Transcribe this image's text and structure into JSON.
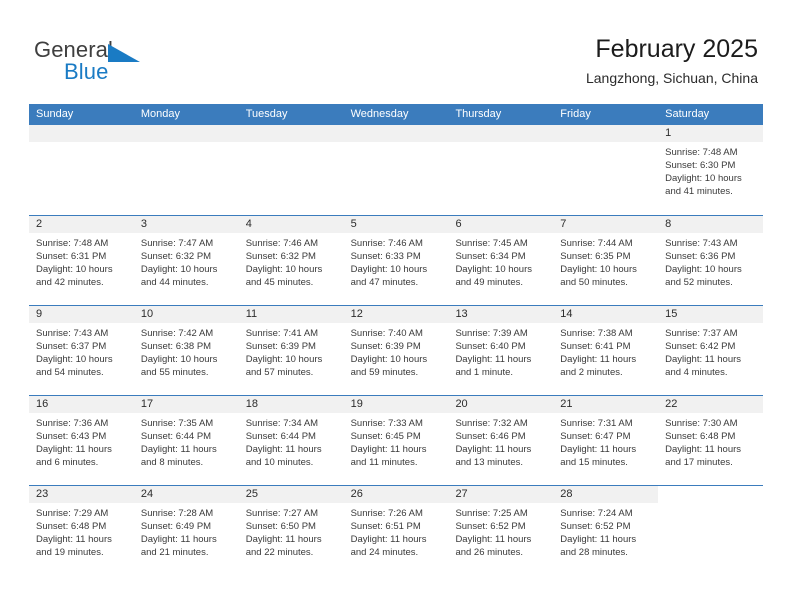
{
  "brand": {
    "name_part1": "General",
    "name_part2": "Blue",
    "accent_color": "#1a7bc4"
  },
  "header": {
    "title": "February 2025",
    "subtitle": "Langzhong, Sichuan, China"
  },
  "calendar": {
    "header_color": "#3b7cbd",
    "band_color": "#f1f1f1",
    "weekdays": [
      "Sunday",
      "Monday",
      "Tuesday",
      "Wednesday",
      "Thursday",
      "Friday",
      "Saturday"
    ],
    "weeks": [
      [
        {
          "day": "",
          "empty": true
        },
        {
          "day": "",
          "empty": true
        },
        {
          "day": "",
          "empty": true
        },
        {
          "day": "",
          "empty": true
        },
        {
          "day": "",
          "empty": true
        },
        {
          "day": "",
          "empty": true
        },
        {
          "day": "1",
          "sunrise": "Sunrise: 7:48 AM",
          "sunset": "Sunset: 6:30 PM",
          "daylight": "Daylight: 10 hours and 41 minutes."
        }
      ],
      [
        {
          "day": "2",
          "sunrise": "Sunrise: 7:48 AM",
          "sunset": "Sunset: 6:31 PM",
          "daylight": "Daylight: 10 hours and 42 minutes."
        },
        {
          "day": "3",
          "sunrise": "Sunrise: 7:47 AM",
          "sunset": "Sunset: 6:32 PM",
          "daylight": "Daylight: 10 hours and 44 minutes."
        },
        {
          "day": "4",
          "sunrise": "Sunrise: 7:46 AM",
          "sunset": "Sunset: 6:32 PM",
          "daylight": "Daylight: 10 hours and 45 minutes."
        },
        {
          "day": "5",
          "sunrise": "Sunrise: 7:46 AM",
          "sunset": "Sunset: 6:33 PM",
          "daylight": "Daylight: 10 hours and 47 minutes."
        },
        {
          "day": "6",
          "sunrise": "Sunrise: 7:45 AM",
          "sunset": "Sunset: 6:34 PM",
          "daylight": "Daylight: 10 hours and 49 minutes."
        },
        {
          "day": "7",
          "sunrise": "Sunrise: 7:44 AM",
          "sunset": "Sunset: 6:35 PM",
          "daylight": "Daylight: 10 hours and 50 minutes."
        },
        {
          "day": "8",
          "sunrise": "Sunrise: 7:43 AM",
          "sunset": "Sunset: 6:36 PM",
          "daylight": "Daylight: 10 hours and 52 minutes."
        }
      ],
      [
        {
          "day": "9",
          "sunrise": "Sunrise: 7:43 AM",
          "sunset": "Sunset: 6:37 PM",
          "daylight": "Daylight: 10 hours and 54 minutes."
        },
        {
          "day": "10",
          "sunrise": "Sunrise: 7:42 AM",
          "sunset": "Sunset: 6:38 PM",
          "daylight": "Daylight: 10 hours and 55 minutes."
        },
        {
          "day": "11",
          "sunrise": "Sunrise: 7:41 AM",
          "sunset": "Sunset: 6:39 PM",
          "daylight": "Daylight: 10 hours and 57 minutes."
        },
        {
          "day": "12",
          "sunrise": "Sunrise: 7:40 AM",
          "sunset": "Sunset: 6:39 PM",
          "daylight": "Daylight: 10 hours and 59 minutes."
        },
        {
          "day": "13",
          "sunrise": "Sunrise: 7:39 AM",
          "sunset": "Sunset: 6:40 PM",
          "daylight": "Daylight: 11 hours and 1 minute."
        },
        {
          "day": "14",
          "sunrise": "Sunrise: 7:38 AM",
          "sunset": "Sunset: 6:41 PM",
          "daylight": "Daylight: 11 hours and 2 minutes."
        },
        {
          "day": "15",
          "sunrise": "Sunrise: 7:37 AM",
          "sunset": "Sunset: 6:42 PM",
          "daylight": "Daylight: 11 hours and 4 minutes."
        }
      ],
      [
        {
          "day": "16",
          "sunrise": "Sunrise: 7:36 AM",
          "sunset": "Sunset: 6:43 PM",
          "daylight": "Daylight: 11 hours and 6 minutes."
        },
        {
          "day": "17",
          "sunrise": "Sunrise: 7:35 AM",
          "sunset": "Sunset: 6:44 PM",
          "daylight": "Daylight: 11 hours and 8 minutes."
        },
        {
          "day": "18",
          "sunrise": "Sunrise: 7:34 AM",
          "sunset": "Sunset: 6:44 PM",
          "daylight": "Daylight: 11 hours and 10 minutes."
        },
        {
          "day": "19",
          "sunrise": "Sunrise: 7:33 AM",
          "sunset": "Sunset: 6:45 PM",
          "daylight": "Daylight: 11 hours and 11 minutes."
        },
        {
          "day": "20",
          "sunrise": "Sunrise: 7:32 AM",
          "sunset": "Sunset: 6:46 PM",
          "daylight": "Daylight: 11 hours and 13 minutes."
        },
        {
          "day": "21",
          "sunrise": "Sunrise: 7:31 AM",
          "sunset": "Sunset: 6:47 PM",
          "daylight": "Daylight: 11 hours and 15 minutes."
        },
        {
          "day": "22",
          "sunrise": "Sunrise: 7:30 AM",
          "sunset": "Sunset: 6:48 PM",
          "daylight": "Daylight: 11 hours and 17 minutes."
        }
      ],
      [
        {
          "day": "23",
          "sunrise": "Sunrise: 7:29 AM",
          "sunset": "Sunset: 6:48 PM",
          "daylight": "Daylight: 11 hours and 19 minutes."
        },
        {
          "day": "24",
          "sunrise": "Sunrise: 7:28 AM",
          "sunset": "Sunset: 6:49 PM",
          "daylight": "Daylight: 11 hours and 21 minutes."
        },
        {
          "day": "25",
          "sunrise": "Sunrise: 7:27 AM",
          "sunset": "Sunset: 6:50 PM",
          "daylight": "Daylight: 11 hours and 22 minutes."
        },
        {
          "day": "26",
          "sunrise": "Sunrise: 7:26 AM",
          "sunset": "Sunset: 6:51 PM",
          "daylight": "Daylight: 11 hours and 24 minutes."
        },
        {
          "day": "27",
          "sunrise": "Sunrise: 7:25 AM",
          "sunset": "Sunset: 6:52 PM",
          "daylight": "Daylight: 11 hours and 26 minutes."
        },
        {
          "day": "28",
          "sunrise": "Sunrise: 7:24 AM",
          "sunset": "Sunset: 6:52 PM",
          "daylight": "Daylight: 11 hours and 28 minutes."
        },
        {
          "day": "",
          "empty": true,
          "blank": true
        }
      ]
    ]
  }
}
